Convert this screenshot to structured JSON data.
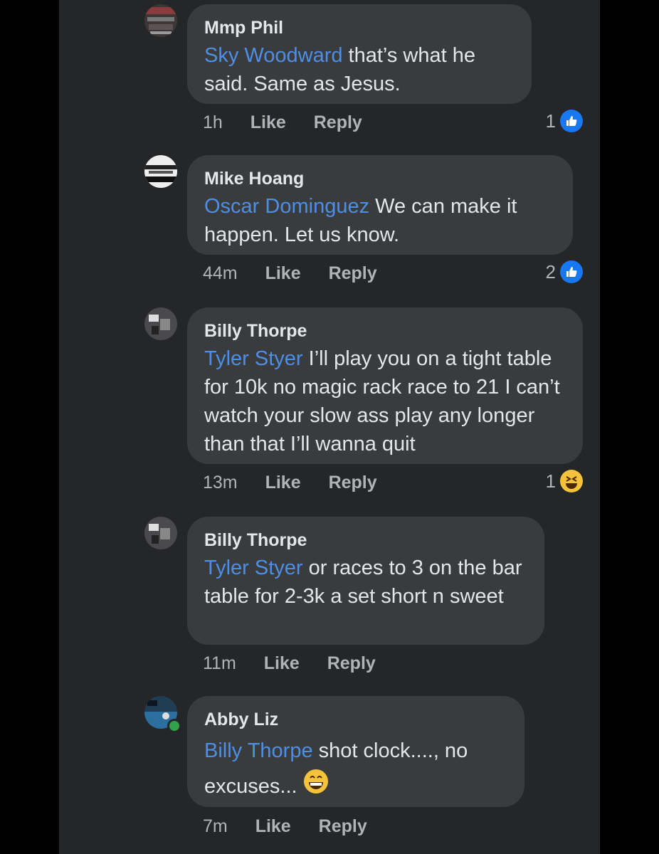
{
  "comments": [
    {
      "author": "Mmp Phil",
      "mention": "Sky Woodward",
      "text": " that’s what he said. Same as Jesus.",
      "time": "1h",
      "like_label": "Like",
      "reply_label": "Reply",
      "reaction_count": "1",
      "reaction_icon": "like-icon"
    },
    {
      "author": "Mike Hoang",
      "mention": "Oscar Dominguez",
      "text": " We can make it happen.  Let us know.",
      "time": "44m",
      "like_label": "Like",
      "reply_label": "Reply",
      "reaction_count": "2",
      "reaction_icon": "like-icon"
    },
    {
      "author": "Billy Thorpe",
      "mention": "Tyler Styer",
      "text": " I’ll play you on a tight table for 10k no magic rack race to 21 I can’t watch your slow ass play any longer than that I’ll wanna quit",
      "time": "13m",
      "like_label": "Like",
      "reply_label": "Reply",
      "reaction_count": "1",
      "reaction_icon": "haha-icon"
    },
    {
      "author": "Billy Thorpe",
      "mention": "Tyler Styer",
      "text": " or races to 3 on the bar table for 2-3k a set short n sweet",
      "time": "11m",
      "like_label": "Like",
      "reply_label": "Reply"
    },
    {
      "author": "Abby Liz",
      "mention": "Billy Thorpe",
      "text": " shot clock...., no excuses...",
      "time": "7m",
      "like_label": "Like",
      "reply_label": "Reply",
      "emoji_icon": "grinning-face-icon"
    }
  ],
  "colors": {
    "background": "#252628",
    "bubble": "#3a3b3d",
    "mention": "#4d8fe6",
    "like_blue": "#1877f2",
    "online_green": "#31a24c"
  }
}
